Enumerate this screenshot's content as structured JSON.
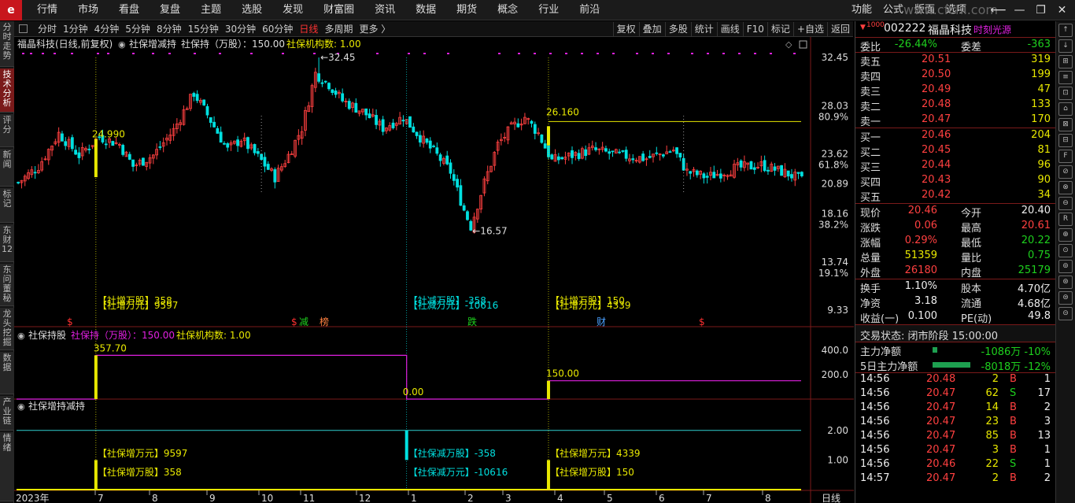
{
  "app": {
    "logo_glyph": "e",
    "menu": [
      "行情",
      "市场",
      "看盘",
      "复盘",
      "主题",
      "选股",
      "发现",
      "财富圈",
      "资讯",
      "数据",
      "期货",
      "概念",
      "行业",
      "前沿"
    ],
    "right_menu": [
      "功能",
      "公式",
      "版面",
      "选项"
    ],
    "watermark": "www.cfchi.com"
  },
  "left_nav": [
    {
      "label": "分时走势",
      "active": false
    },
    {
      "label": "技术分析",
      "active": true
    },
    {
      "label": "评分",
      "active": false
    },
    {
      "label": "新闻",
      "active": false
    },
    {
      "label": "标记",
      "active": false
    },
    {
      "label": "东财12",
      "active": false
    },
    {
      "label": "东问董秘",
      "active": false
    },
    {
      "label": "龙头挖掘",
      "active": false
    },
    {
      "label": "数据",
      "active": false
    },
    {
      "label": "产业链",
      "active": false
    },
    {
      "label": "情绪",
      "active": false
    }
  ],
  "toolbar": {
    "periods": [
      "分时",
      "1分钟",
      "4分钟",
      "5分钟",
      "8分钟",
      "15分钟",
      "30分钟",
      "60分钟",
      "日线",
      "多周期",
      "更多 〉"
    ],
    "selected": "日线",
    "tools": [
      "复权",
      "叠加",
      "多股",
      "统计",
      "画线",
      "F10",
      "标记",
      "+自选",
      "返回"
    ]
  },
  "main_chart": {
    "title": "福晶科技(日线,前复权)",
    "indicator_name": "社保增减持",
    "indicator_value": "社保持（万股）：150.00",
    "indicator_extra": "社保机构数: 1.00",
    "y_labels": [
      {
        "v": "32.45",
        "p": null
      },
      {
        "v": "28.03",
        "p": "80.9%"
      },
      {
        "v": "23.62",
        "p": "61.8%"
      },
      {
        "v": "20.89",
        "p": null
      },
      {
        "v": "18.16",
        "p": "38.2%"
      },
      {
        "v": "13.74",
        "p": "19.1%"
      },
      {
        "v": "9.33",
        "p": null
      }
    ],
    "high_label": "32.45",
    "low_label": "16.57",
    "annot_prices": [
      "24.990",
      "26.160"
    ],
    "events": [
      {
        "line1": "【社增万股】358",
        "line2": "【社增万元】9597",
        "color": "yellow"
      },
      {
        "line1": "【社减万股】-358",
        "line2": "【社减万元】-10616",
        "color": "cyan"
      },
      {
        "line1": "【社增万股】150",
        "line2": "【社增万元】4339",
        "color": "yellow"
      }
    ],
    "markers": [
      {
        "t": "$",
        "c": "#ff3030"
      },
      {
        "t": "$",
        "c": "#ff3030"
      },
      {
        "t": "减",
        "c": "#1ed01e"
      },
      {
        "t": "榜",
        "c": "#ff8040"
      },
      {
        "t": "跌",
        "c": "#1ed01e"
      },
      {
        "t": "财",
        "c": "#4aa0ff"
      },
      {
        "t": "$",
        "c": "#ff3030"
      }
    ]
  },
  "panel2": {
    "title": "社保持股",
    "indicator_value": "社保持（万股）：150.00",
    "indicator_extra": "社保机构数: 1.00",
    "y_labels": [
      "400.0",
      "200.0"
    ],
    "value_labels": [
      "357.70",
      "0.00",
      "150.00"
    ]
  },
  "panel3": {
    "title": "社保增持减持",
    "y_labels": [
      "2.00",
      "1.00"
    ],
    "labels": [
      {
        "a": "【社保增万元】9597",
        "b": "【社保增万股】358",
        "color": "yellow"
      },
      {
        "a": "【社保减万股】-358",
        "b": "【社保减万元】-10616",
        "color": "cyan"
      },
      {
        "a": "【社保增万元】4339",
        "b": "【社保增万股】150",
        "color": "yellow"
      }
    ]
  },
  "x_axis": {
    "labels": [
      "2023年",
      "7",
      "8",
      "9",
      "10",
      "11",
      "12",
      "1",
      "2",
      "3",
      "4",
      "5",
      "6",
      "7",
      "8"
    ],
    "period_label": "日线"
  },
  "quote": {
    "code": "002222",
    "name": "福晶科技",
    "badge": "1000",
    "source": "时刻光源",
    "weibi": {
      "label": "委比",
      "value": "-26.44%"
    },
    "weicha": {
      "label": "委差",
      "value": "-363"
    },
    "asks": [
      {
        "label": "卖五",
        "price": "20.51",
        "vol": "319"
      },
      {
        "label": "卖四",
        "price": "20.50",
        "vol": "199"
      },
      {
        "label": "卖三",
        "price": "20.49",
        "vol": "47"
      },
      {
        "label": "卖二",
        "price": "20.48",
        "vol": "133"
      },
      {
        "label": "卖一",
        "price": "20.47",
        "vol": "170"
      }
    ],
    "bids": [
      {
        "label": "买一",
        "price": "20.46",
        "vol": "204"
      },
      {
        "label": "买二",
        "price": "20.45",
        "vol": "81"
      },
      {
        "label": "买三",
        "price": "20.44",
        "vol": "96"
      },
      {
        "label": "买四",
        "price": "20.43",
        "vol": "90"
      },
      {
        "label": "买五",
        "price": "20.42",
        "vol": "34"
      }
    ],
    "stats": [
      {
        "l": "现价",
        "v": "20.46",
        "vc": "red",
        "l2": "今开",
        "v2": "20.40",
        "v2c": "white"
      },
      {
        "l": "涨跌",
        "v": "0.06",
        "vc": "red",
        "l2": "最高",
        "v2": "20.61",
        "v2c": "red"
      },
      {
        "l": "涨幅",
        "v": "0.29%",
        "vc": "red",
        "l2": "最低",
        "v2": "20.22",
        "v2c": "green"
      },
      {
        "l": "总量",
        "v": "51359",
        "vc": "yellow",
        "l2": "量比",
        "v2": "0.75",
        "v2c": "green"
      },
      {
        "l": "外盘",
        "v": "26180",
        "vc": "red",
        "l2": "内盘",
        "v2": "25179",
        "v2c": "green"
      }
    ],
    "stats2": [
      {
        "l": "换手",
        "v": "1.10%",
        "vc": "white",
        "l2": "股本",
        "v2": "4.70亿",
        "v2c": "white"
      },
      {
        "l": "净资",
        "v": "3.18",
        "vc": "white",
        "l2": "流通",
        "v2": "4.68亿",
        "v2c": "white"
      },
      {
        "l": "收益(一)",
        "v": "0.100",
        "vc": "white",
        "l2": "PE(动)",
        "v2": "49.8",
        "v2c": "white"
      }
    ],
    "trade_status": "交易状态: 闭市阶段 15:00:00",
    "flow": [
      {
        "label": "主力净额",
        "value": "-1086万 -10%"
      },
      {
        "label": "5日主力净额",
        "value": "-8018万 -12%"
      }
    ],
    "ticks": [
      {
        "t": "14:56",
        "p": "20.48",
        "v": "2",
        "s": "B",
        "n": "1"
      },
      {
        "t": "14:56",
        "p": "20.47",
        "v": "62",
        "s": "S",
        "n": "17"
      },
      {
        "t": "14:56",
        "p": "20.47",
        "v": "14",
        "s": "B",
        "n": "2"
      },
      {
        "t": "14:56",
        "p": "20.47",
        "v": "23",
        "s": "B",
        "n": "3"
      },
      {
        "t": "14:56",
        "p": "20.47",
        "v": "85",
        "s": "B",
        "n": "13"
      },
      {
        "t": "14:56",
        "p": "20.47",
        "v": "3",
        "s": "B",
        "n": "1"
      },
      {
        "t": "14:56",
        "p": "20.46",
        "v": "22",
        "s": "S",
        "n": "1"
      },
      {
        "t": "14:57",
        "p": "20.47",
        "v": "2",
        "s": "B",
        "n": "2"
      }
    ]
  },
  "right_tools": [
    "↑",
    "↓",
    "⊞",
    "≡",
    "⊡",
    "⌂",
    "⊠",
    "⊟",
    "F",
    "⊘",
    "⊗",
    "⊖",
    "R",
    "⊕",
    "⊙",
    "⊚",
    "⊛",
    "⊜",
    "⊝"
  ],
  "colors": {
    "up": "#ff4040",
    "down": "#00e0e0",
    "yellow": "#e8e800",
    "magenta": "#e020e0",
    "grid": "#7a1a1a"
  },
  "chart_data": {
    "type": "candlestick",
    "ylim": [
      9.33,
      32.45
    ],
    "price_path": [
      [
        0,
        21.0
      ],
      [
        6,
        22.5
      ],
      [
        12,
        25.5
      ],
      [
        18,
        23.5
      ],
      [
        24,
        25.2
      ],
      [
        30,
        24.5
      ],
      [
        34,
        22.5
      ],
      [
        40,
        23.5
      ],
      [
        46,
        25.8
      ],
      [
        52,
        29.2
      ],
      [
        56,
        27.2
      ],
      [
        62,
        24.0
      ],
      [
        66,
        25.0
      ],
      [
        72,
        23.0
      ],
      [
        76,
        21.5
      ],
      [
        80,
        23.5
      ],
      [
        84,
        26.0
      ],
      [
        88,
        31.0
      ],
      [
        92,
        30.0
      ],
      [
        96,
        28.5
      ],
      [
        102,
        27.5
      ],
      [
        108,
        26.0
      ],
      [
        114,
        27.0
      ],
      [
        120,
        24.8
      ],
      [
        124,
        23.5
      ],
      [
        128,
        22.0
      ],
      [
        132,
        18.5
      ],
      [
        134,
        17.0
      ],
      [
        138,
        21.0
      ],
      [
        142,
        24.5
      ],
      [
        146,
        26.0
      ],
      [
        150,
        27.0
      ],
      [
        154,
        25.5
      ],
      [
        158,
        23.0
      ],
      [
        164,
        23.5
      ],
      [
        170,
        24.0
      ],
      [
        178,
        23.5
      ],
      [
        186,
        23.2
      ],
      [
        194,
        24.0
      ],
      [
        198,
        22.0
      ],
      [
        204,
        21.5
      ],
      [
        212,
        22.3
      ],
      [
        220,
        22.6
      ],
      [
        228,
        21.8
      ],
      [
        232,
        21.2
      ]
    ],
    "n_bars": 233,
    "high": {
      "i": 89,
      "v": 32.45
    },
    "low": {
      "i": 134,
      "v": 16.57
    },
    "event_bars": [
      23,
      115,
      157
    ],
    "holding": {
      "ylim": [
        0,
        450
      ],
      "segments": [
        {
          "from": 0,
          "to": 23,
          "v": 0
        },
        {
          "from": 23,
          "to": 115,
          "v": 357.7
        },
        {
          "from": 115,
          "to": 157,
          "v": 0
        },
        {
          "from": 157,
          "to": 232,
          "v": 150
        }
      ]
    },
    "change": {
      "ylim": [
        0,
        2.5
      ],
      "flat": 2.0,
      "events": [
        {
          "i": 23,
          "v": 1.0,
          "dir": "up"
        },
        {
          "i": 115,
          "v": 1.0,
          "dir": "down"
        },
        {
          "i": 157,
          "v": 1.0,
          "dir": "up"
        }
      ]
    }
  }
}
